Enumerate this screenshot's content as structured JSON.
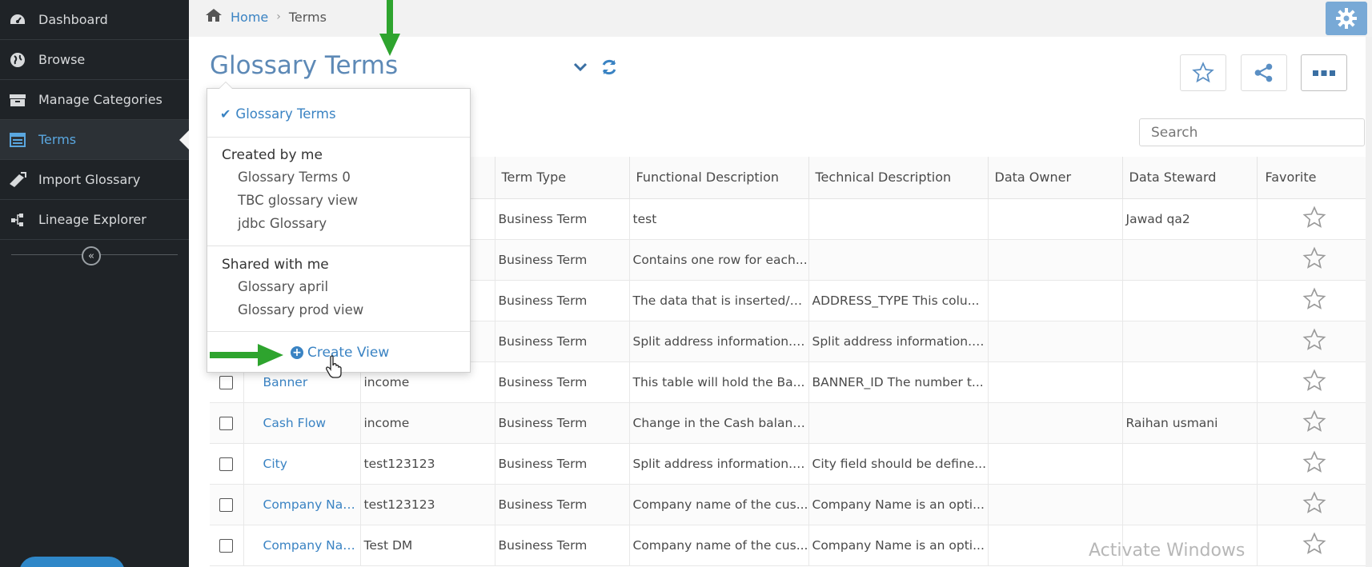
{
  "sidebar": {
    "items": [
      {
        "label": "Dashboard",
        "icon": "dashboard-gauge-icon"
      },
      {
        "label": "Browse",
        "icon": "globe-icon"
      },
      {
        "label": "Manage Categories",
        "icon": "archive-box-icon"
      },
      {
        "label": "Terms",
        "icon": "table-list-icon"
      },
      {
        "label": "Import Glossary",
        "icon": "book-import-icon"
      },
      {
        "label": "Lineage Explorer",
        "icon": "lineage-tree-icon"
      }
    ],
    "active_item": "Terms",
    "collapse_glyph": "«"
  },
  "breadcrumb": {
    "home": "Home",
    "separator": "›",
    "current": "Terms"
  },
  "page": {
    "title": "Glossary Terms"
  },
  "search": {
    "placeholder": "Search"
  },
  "dropdown": {
    "selected": "Glossary Terms",
    "check_glyph": "✔",
    "created_by_me": {
      "header": "Created by me",
      "items": [
        "Glossary Terms 0",
        "TBC glossary view",
        "jdbc Glossary"
      ]
    },
    "shared_with_me": {
      "header": "Shared with me",
      "items": [
        "Glossary april",
        "Glossary prod view"
      ]
    },
    "create_view": "Create View",
    "create_glyph": "+"
  },
  "table": {
    "headers": [
      "Term Type",
      "Functional Description",
      "Technical Description",
      "Data Owner",
      "Data Steward",
      "Favorite"
    ],
    "rows": [
      {
        "name": "",
        "category": "",
        "type": "Business Term",
        "functional": "test",
        "technical": "",
        "owner": "",
        "steward": "Jawad qa2"
      },
      {
        "name": "",
        "category": "",
        "type": "Business Term",
        "functional": "Contains one row for each...",
        "technical": "",
        "owner": "",
        "steward": ""
      },
      {
        "name": "",
        "category": "",
        "type": "Business Term",
        "functional": "The data that is inserted/u...",
        "technical": "ADDRESS_TYPE This colu...",
        "owner": "",
        "steward": ""
      },
      {
        "name": "",
        "category": "",
        "type": "Business Term",
        "functional": "Split address information. ...",
        "technical": "Split address information. ...",
        "owner": "",
        "steward": ""
      },
      {
        "name": "Banner",
        "category": "income",
        "type": "Business Term",
        "functional": "This table will hold the Ba...",
        "technical": "BANNER_ID The number t...",
        "owner": "",
        "steward": ""
      },
      {
        "name": "Cash Flow",
        "category": "income",
        "type": "Business Term",
        "functional": "Change in the Cash balanc...",
        "technical": "",
        "owner": "",
        "steward": "Raihan usmani"
      },
      {
        "name": "City",
        "category": "test123123",
        "type": "Business Term",
        "functional": "Split address information. ...",
        "technical": "City field should be define...",
        "owner": "",
        "steward": ""
      },
      {
        "name": "Company Name",
        "category": "test123123",
        "type": "Business Term",
        "functional": "Company name of the cus...",
        "technical": "Company Name is an opti...",
        "owner": "",
        "steward": ""
      },
      {
        "name": "Company Name",
        "category": "Test DM",
        "type": "Business Term",
        "functional": "Company name of the cus...",
        "technical": "Company Name is an opti...",
        "owner": "",
        "steward": ""
      }
    ]
  },
  "watermark": "Activate Windows",
  "colors": {
    "sidebar_bg": "#1f2327",
    "accent_blue": "#3a83c3",
    "title_blue": "#5d89b6",
    "annotation_green": "#2ea42e",
    "gear_bg": "#78a9d6"
  }
}
